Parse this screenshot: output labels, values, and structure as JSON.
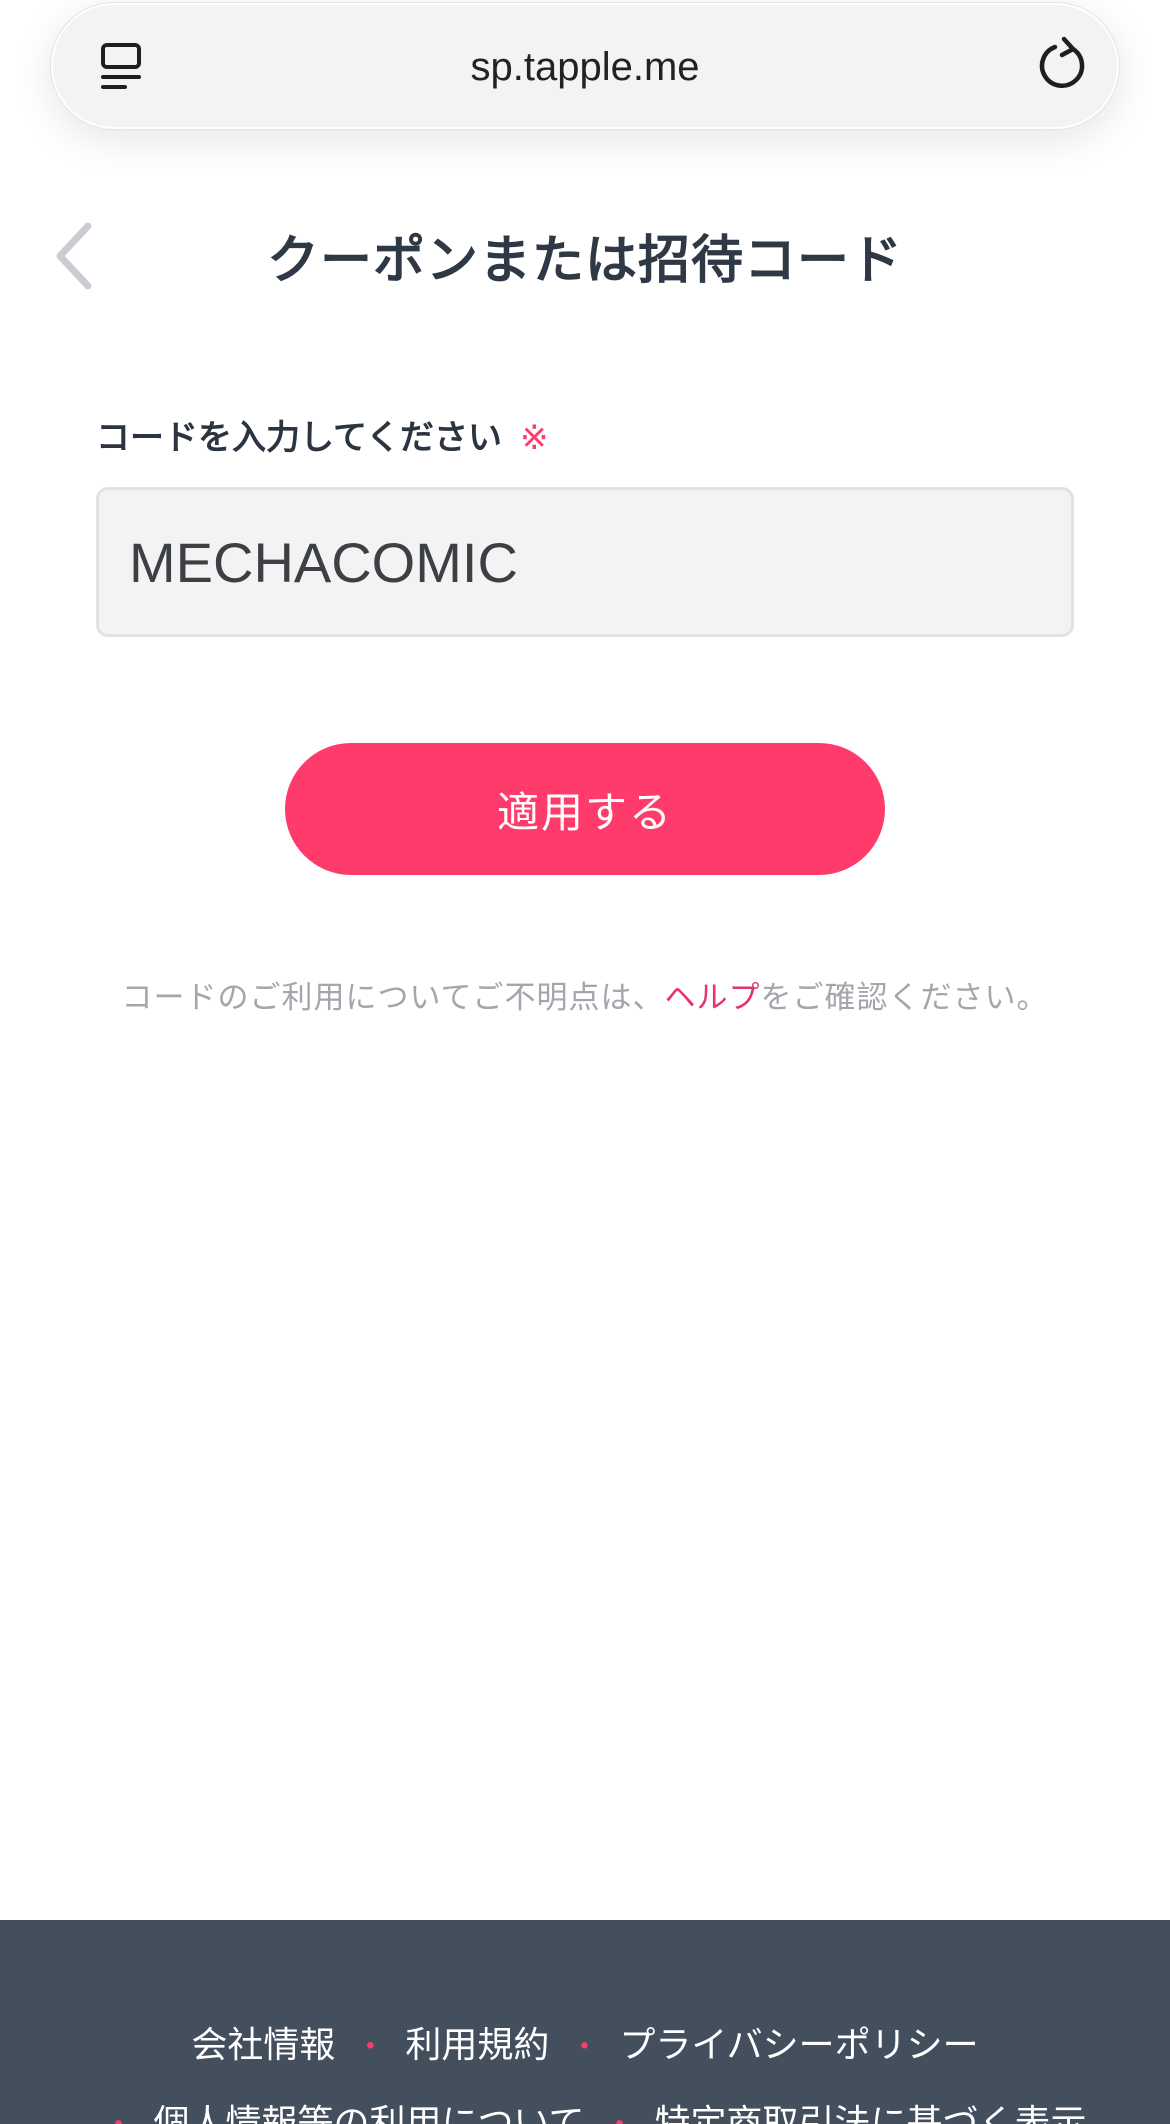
{
  "browser": {
    "url": "sp.tapple.me",
    "tabs_icon": "tabs-list-icon",
    "reload_icon": "reload-icon"
  },
  "header": {
    "title": "クーポンまたは招待コード",
    "back_icon": "chevron-left-icon"
  },
  "form": {
    "label": "コードを入力してください",
    "required_mark": "※",
    "code_value": "MECHACOMIC",
    "apply_label": "適用する"
  },
  "help": {
    "before": "コードのご利用についてご不明点は、",
    "link": "ヘルプ",
    "after": "をご確認ください。"
  },
  "footer": {
    "separator": "・",
    "row1": [
      "会社情報",
      "利用規約",
      "プライバシーポリシー"
    ],
    "row2": [
      "個人情報等の利用について",
      "特定商取引法に基づく表示"
    ]
  },
  "colors": {
    "accent": "#ff3b6b",
    "link": "#e6356b",
    "footer_bg": "#444f5e",
    "title_text": "#2f3946"
  }
}
